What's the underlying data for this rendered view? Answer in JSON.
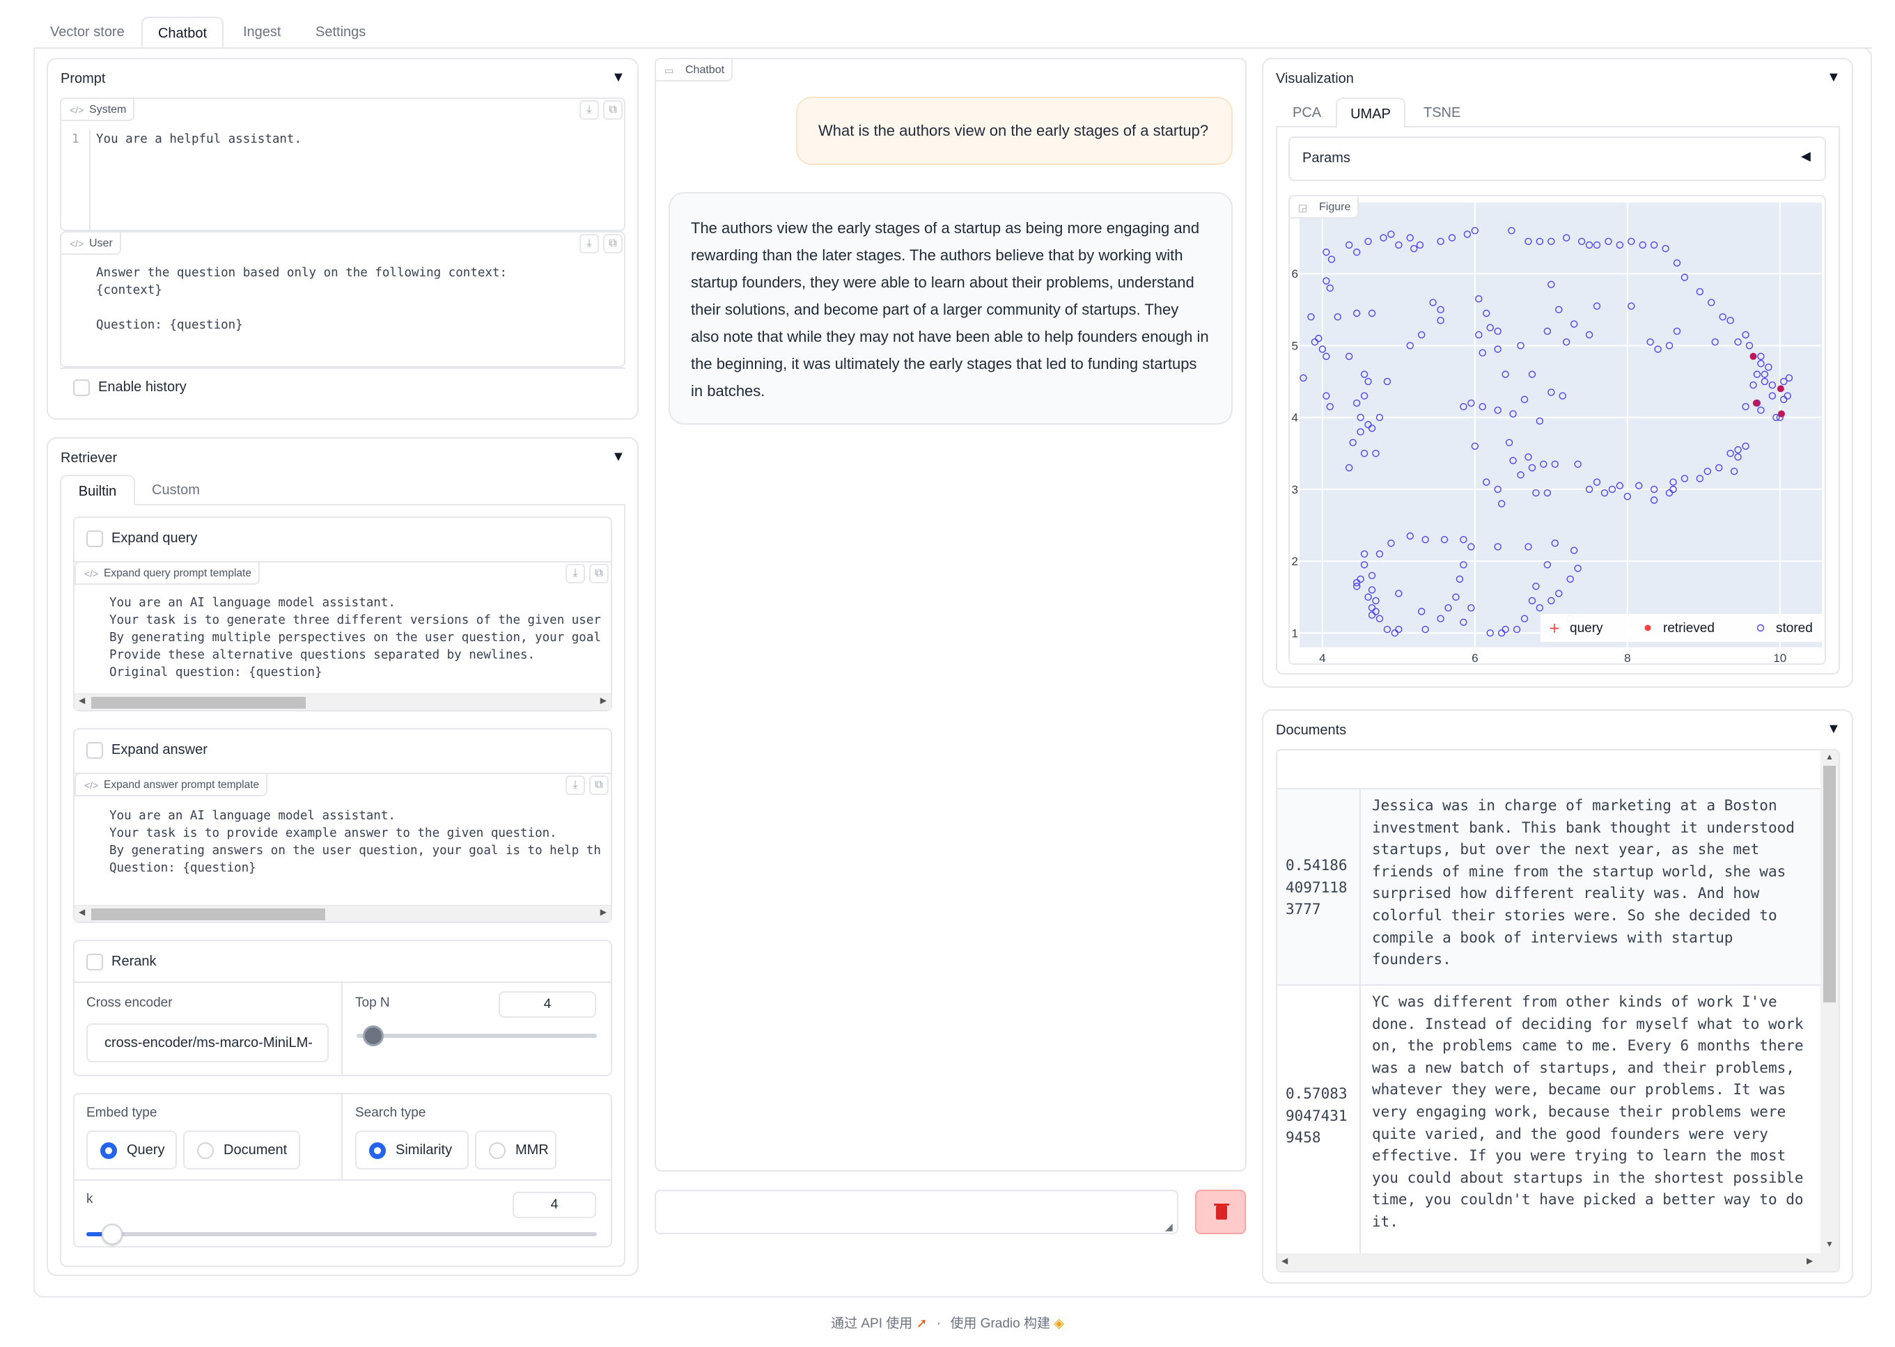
{
  "tabs": [
    "Vector store",
    "Chatbot",
    "Ingest",
    "Settings"
  ],
  "active_tab": "Chatbot",
  "prompt": {
    "title": "Prompt",
    "system_label": "System",
    "system_line_no": "1",
    "system_text": "You are a helpful assistant.",
    "user_label": "User",
    "user_text": "Answer the question based only on the following context:\n{context}\n\nQuestion: {question}",
    "enable_history": "Enable history"
  },
  "retriever": {
    "title": "Retriever",
    "tabs": [
      "Builtin",
      "Custom"
    ],
    "expand_query": "Expand query",
    "expand_query_template_label": "Expand query prompt template",
    "expand_query_template": "You are an AI language model assistant.\nYour task is to generate three different versions of the given user\nBy generating multiple perspectives on the user question, your goal\nProvide these alternative questions separated by newlines.\nOriginal question: {question}",
    "expand_answer": "Expand answer",
    "expand_answer_template_label": "Expand answer prompt template",
    "expand_answer_template": "You are an AI language model assistant.\nYour task is to provide example answer to the given question.\nBy generating answers on the user question, your goal is to help th\nQuestion: {question}",
    "rerank": "Rerank",
    "cross_encoder_label": "Cross encoder",
    "cross_encoder_value": "cross-encoder/ms-marco-MiniLM-",
    "top_n_label": "Top N",
    "top_n_value": "4",
    "top_n_fraction": 0.07,
    "embed_type_label": "Embed type",
    "embed_options": [
      "Query",
      "Document"
    ],
    "embed_selected": "Query",
    "search_type_label": "Search type",
    "search_options": [
      "Similarity",
      "MMR"
    ],
    "search_selected": "Similarity",
    "k_label": "k",
    "k_value": "4",
    "k_fraction": 0.05
  },
  "chat": {
    "label": "Chatbot",
    "user_message": "What is the authors view on the early stages of a startup?",
    "bot_message": "The authors view the early stages of a startup as being more engaging and rewarding than the later stages. The authors believe that by working with startup founders, they were able to learn about their problems, understand their solutions, and become part of a larger community of startups. They also note that while they may not have been able to help founders enough in the beginning, it was ultimately the early stages that led to funding startups in batches.",
    "input_placeholder": "",
    "delete_icon": "trash-icon"
  },
  "visualization": {
    "title": "Visualization",
    "tabs": [
      "PCA",
      "UMAP",
      "TSNE"
    ],
    "active_tab": "UMAP",
    "params_label": "Params",
    "figure_label": "Figure"
  },
  "chart_data": {
    "type": "scatter",
    "xlim": [
      3.7,
      10.55
    ],
    "ylim": [
      0.8,
      7.0
    ],
    "x_ticks": [
      "4",
      "6",
      "8",
      "10"
    ],
    "y_ticks": [
      "1",
      "2",
      "3",
      "4",
      "5",
      "6",
      "7"
    ],
    "legend": [
      "query",
      "retrieved",
      "stored"
    ],
    "legend_position": "bottom-right",
    "colors": {
      "query": "#ef4444",
      "retrieved": "#be185d",
      "stored": "#4f46e5",
      "plot_bg": "#e5ecf6"
    },
    "series": [
      {
        "name": "retrieved",
        "points": [
          [
            9.69,
            4.2
          ],
          [
            10.02,
            4.05
          ],
          [
            10.01,
            4.4
          ],
          [
            9.65,
            4.85
          ]
        ]
      },
      {
        "name": "stored",
        "points": [
          [
            6.48,
            6.6
          ],
          [
            5.28,
            6.4
          ],
          [
            5.55,
            6.45
          ],
          [
            5.7,
            6.5
          ],
          [
            5.9,
            6.55
          ],
          [
            6.0,
            6.6
          ],
          [
            4.05,
            6.3
          ],
          [
            4.12,
            6.2
          ],
          [
            4.35,
            6.4
          ],
          [
            4.45,
            6.3
          ],
          [
            4.6,
            6.45
          ],
          [
            4.8,
            6.5
          ],
          [
            4.9,
            6.55
          ],
          [
            5.0,
            6.4
          ],
          [
            5.15,
            6.5
          ],
          [
            5.2,
            6.35
          ],
          [
            4.05,
            5.9
          ],
          [
            4.1,
            5.8
          ],
          [
            3.85,
            5.4
          ],
          [
            3.9,
            5.05
          ],
          [
            4.0,
            4.95
          ],
          [
            4.05,
            4.85
          ],
          [
            3.95,
            5.1
          ],
          [
            3.75,
            4.55
          ],
          [
            4.05,
            4.3
          ],
          [
            4.1,
            4.15
          ],
          [
            4.45,
            4.2
          ],
          [
            4.5,
            4.0
          ],
          [
            4.6,
            3.9
          ],
          [
            4.65,
            3.85
          ],
          [
            4.5,
            3.8
          ],
          [
            4.4,
            3.65
          ],
          [
            4.7,
            3.5
          ],
          [
            4.35,
            3.3
          ],
          [
            4.55,
            3.5
          ],
          [
            4.2,
            5.4
          ],
          [
            4.45,
            5.45
          ],
          [
            4.65,
            5.45
          ],
          [
            4.85,
            4.5
          ],
          [
            5.15,
            5.0
          ],
          [
            6.7,
            6.45
          ],
          [
            6.85,
            6.45
          ],
          [
            7.0,
            6.45
          ],
          [
            7.2,
            6.5
          ],
          [
            7.4,
            6.45
          ],
          [
            7.5,
            6.4
          ],
          [
            7.6,
            6.4
          ],
          [
            7.75,
            6.45
          ],
          [
            7.9,
            6.4
          ],
          [
            8.05,
            6.45
          ],
          [
            8.2,
            6.4
          ],
          [
            8.35,
            6.4
          ],
          [
            8.5,
            6.35
          ],
          [
            8.65,
            6.15
          ],
          [
            8.75,
            5.95
          ],
          [
            8.95,
            5.75
          ],
          [
            9.1,
            5.6
          ],
          [
            9.25,
            5.4
          ],
          [
            9.35,
            5.35
          ],
          [
            9.55,
            5.15
          ],
          [
            9.6,
            5.0
          ],
          [
            9.75,
            4.75
          ],
          [
            9.8,
            4.6
          ],
          [
            9.9,
            4.45
          ],
          [
            10.05,
            4.5
          ],
          [
            10.1,
            4.3
          ],
          [
            9.9,
            4.3
          ],
          [
            9.95,
            4.0
          ],
          [
            9.75,
            4.1
          ],
          [
            9.7,
            4.2
          ],
          [
            5.55,
            5.35
          ],
          [
            5.3,
            5.15
          ],
          [
            5.45,
            5.6
          ],
          [
            5.55,
            5.5
          ],
          [
            6.05,
            5.65
          ],
          [
            6.15,
            5.45
          ],
          [
            6.2,
            5.25
          ],
          [
            6.3,
            5.2
          ],
          [
            6.6,
            5.0
          ],
          [
            6.95,
            5.2
          ],
          [
            7.2,
            5.05
          ],
          [
            7.6,
            5.55
          ],
          [
            8.05,
            5.55
          ],
          [
            8.3,
            5.05
          ],
          [
            8.4,
            4.95
          ],
          [
            8.55,
            5.0
          ],
          [
            8.65,
            5.2
          ],
          [
            9.15,
            5.05
          ],
          [
            7.5,
            5.15
          ],
          [
            7.3,
            5.3
          ],
          [
            7.1,
            5.5
          ],
          [
            7.0,
            5.85
          ],
          [
            5.95,
            4.2
          ],
          [
            6.1,
            4.15
          ],
          [
            6.3,
            4.1
          ],
          [
            6.5,
            4.05
          ],
          [
            6.65,
            4.25
          ],
          [
            6.85,
            3.95
          ],
          [
            7.0,
            4.35
          ],
          [
            7.15,
            4.3
          ],
          [
            6.75,
            4.6
          ],
          [
            6.4,
            4.6
          ],
          [
            6.3,
            4.95
          ],
          [
            6.05,
            5.15
          ],
          [
            6.1,
            4.9
          ],
          [
            5.85,
            4.15
          ],
          [
            6.0,
            3.6
          ],
          [
            6.45,
            3.65
          ],
          [
            6.5,
            3.4
          ],
          [
            6.7,
            3.45
          ],
          [
            6.75,
            3.3
          ],
          [
            6.6,
            3.2
          ],
          [
            6.9,
            3.35
          ],
          [
            7.05,
            3.35
          ],
          [
            7.35,
            3.35
          ],
          [
            6.15,
            3.1
          ],
          [
            6.3,
            3.0
          ],
          [
            6.35,
            2.8
          ],
          [
            6.8,
            2.95
          ],
          [
            6.95,
            2.95
          ],
          [
            7.5,
            3.0
          ],
          [
            7.6,
            3.1
          ],
          [
            7.8,
            3.0
          ],
          [
            7.7,
            2.95
          ],
          [
            7.9,
            3.05
          ],
          [
            8.0,
            2.9
          ],
          [
            8.15,
            3.05
          ],
          [
            8.35,
            3.0
          ],
          [
            8.55,
            2.95
          ],
          [
            8.6,
            3.1
          ],
          [
            8.6,
            3.0
          ],
          [
            8.75,
            3.15
          ],
          [
            8.95,
            3.15
          ],
          [
            9.05,
            3.25
          ],
          [
            9.2,
            3.3
          ],
          [
            9.35,
            3.5
          ],
          [
            9.45,
            3.55
          ],
          [
            9.45,
            3.45
          ],
          [
            9.55,
            3.6
          ],
          [
            9.4,
            3.25
          ],
          [
            8.35,
            2.85
          ],
          [
            7.3,
            2.15
          ],
          [
            7.05,
            2.25
          ],
          [
            6.95,
            1.95
          ],
          [
            6.7,
            2.2
          ],
          [
            6.3,
            2.2
          ],
          [
            5.95,
            2.2
          ],
          [
            5.85,
            2.3
          ],
          [
            5.6,
            2.3
          ],
          [
            5.35,
            2.3
          ],
          [
            5.15,
            2.35
          ],
          [
            4.9,
            2.25
          ],
          [
            4.75,
            2.1
          ],
          [
            4.55,
            2.1
          ],
          [
            4.55,
            1.95
          ],
          [
            4.65,
            1.8
          ],
          [
            4.5,
            1.75
          ],
          [
            4.45,
            1.7
          ],
          [
            4.45,
            1.65
          ],
          [
            4.65,
            1.6
          ],
          [
            4.6,
            1.5
          ],
          [
            4.7,
            1.45
          ],
          [
            4.65,
            1.35
          ],
          [
            4.75,
            1.2
          ],
          [
            4.85,
            1.05
          ],
          [
            4.95,
            1.0
          ],
          [
            5.0,
            1.05
          ],
          [
            5.35,
            1.05
          ],
          [
            5.55,
            1.2
          ],
          [
            5.85,
            1.15
          ],
          [
            6.2,
            1.0
          ],
          [
            6.35,
            1.0
          ],
          [
            6.55,
            1.05
          ],
          [
            6.65,
            1.2
          ],
          [
            6.75,
            1.45
          ],
          [
            6.85,
            1.35
          ],
          [
            7.0,
            1.45
          ],
          [
            7.1,
            1.55
          ],
          [
            7.25,
            1.75
          ],
          [
            7.35,
            1.9
          ],
          [
            5.3,
            1.3
          ],
          [
            4.65,
            1.25
          ],
          [
            4.7,
            1.3
          ],
          [
            5.65,
            1.35
          ],
          [
            5.95,
            1.35
          ],
          [
            5.8,
            1.75
          ],
          [
            5.85,
            1.95
          ],
          [
            7.05,
            0.95
          ],
          [
            6.95,
            1.05
          ],
          [
            7.1,
            1.05
          ],
          [
            6.4,
            1.05
          ],
          [
            7.25,
            1.2
          ],
          [
            6.8,
            1.65
          ],
          [
            5.75,
            1.5
          ],
          [
            5.0,
            1.55
          ],
          [
            4.55,
            4.3
          ],
          [
            4.6,
            4.5
          ],
          [
            4.55,
            4.6
          ],
          [
            4.75,
            4.0
          ],
          [
            4.35,
            4.85
          ],
          [
            10.12,
            4.55
          ],
          [
            9.65,
            4.45
          ],
          [
            9.8,
            4.5
          ],
          [
            9.75,
            4.85
          ],
          [
            10.0,
            4.0
          ],
          [
            10.05,
            4.25
          ],
          [
            9.55,
            4.15
          ],
          [
            9.7,
            4.6
          ],
          [
            9.85,
            4.7
          ],
          [
            9.45,
            5.05
          ]
        ]
      }
    ]
  },
  "documents": {
    "title": "Documents",
    "rows": [
      {
        "score": "0.54186\n4097118\n3777",
        "text": "Jessica was in charge of marketing at a Boston investment bank. This bank thought it understood startups, but over the next year, as she met friends of mine from the startup world, she was surprised how different reality was. And how colorful their stories were. So she decided to compile a book of interviews with startup founders."
      },
      {
        "score": "0.57083\n9047431\n9458",
        "text": "YC was different from other kinds of work I've done. Instead of deciding for myself what to work on, the problems came to me. Every 6 months there was a new batch of startups, and their problems, whatever they were, became our problems. It was very engaging work, because their problems were quite varied, and the good founders were very effective. If you were trying to learn the most you could about startups in the shortest possible time, you couldn't have picked a better way to do it."
      }
    ]
  },
  "footer": {
    "api_text": "通过 API 使用",
    "separator": "·",
    "built_text": "使用 Gradio 构建"
  }
}
